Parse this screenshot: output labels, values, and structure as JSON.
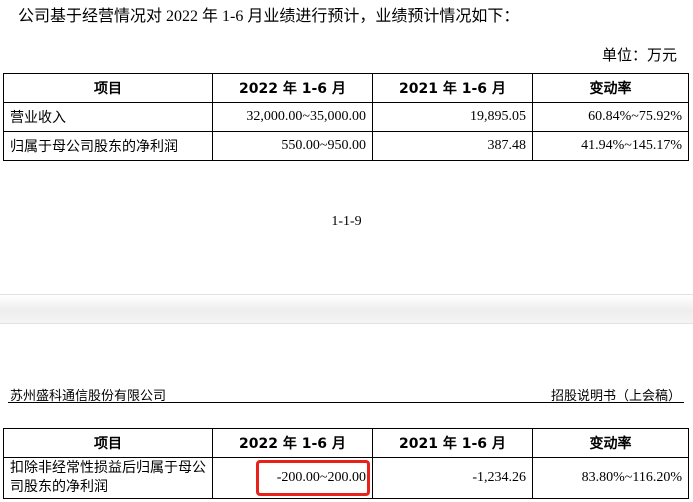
{
  "intro": "公司基于经营情况对 2022 年 1-6 月业绩进行预计，业绩预计情况如下：",
  "unit": "单位：万元",
  "table1": {
    "headers": [
      "项目",
      "2022 年 1-6 月",
      "2021 年 1-6 月",
      "变动率"
    ],
    "rows": [
      [
        "营业收入",
        "32,000.00~35,000.00",
        "19,895.05",
        "60.84%~75.92%"
      ],
      [
        "归属于母公司股东的净利润",
        "550.00~950.00",
        "387.48",
        "41.94%~145.17%"
      ]
    ]
  },
  "page_number": "1-1-9",
  "header": {
    "company": "苏州盛科通信股份有限公司",
    "doc": "招股说明书（上会稿）"
  },
  "table2": {
    "headers": [
      "项目",
      "2022 年 1-6 月",
      "2021 年 1-6 月",
      "变动率"
    ],
    "rows": [
      [
        "扣除非经常性损益后归属于母公司股东的净利润",
        "-200.00~200.00",
        "-1,234.26",
        "83.80%~116.20%"
      ]
    ]
  },
  "highlight_color": "#e8221a"
}
